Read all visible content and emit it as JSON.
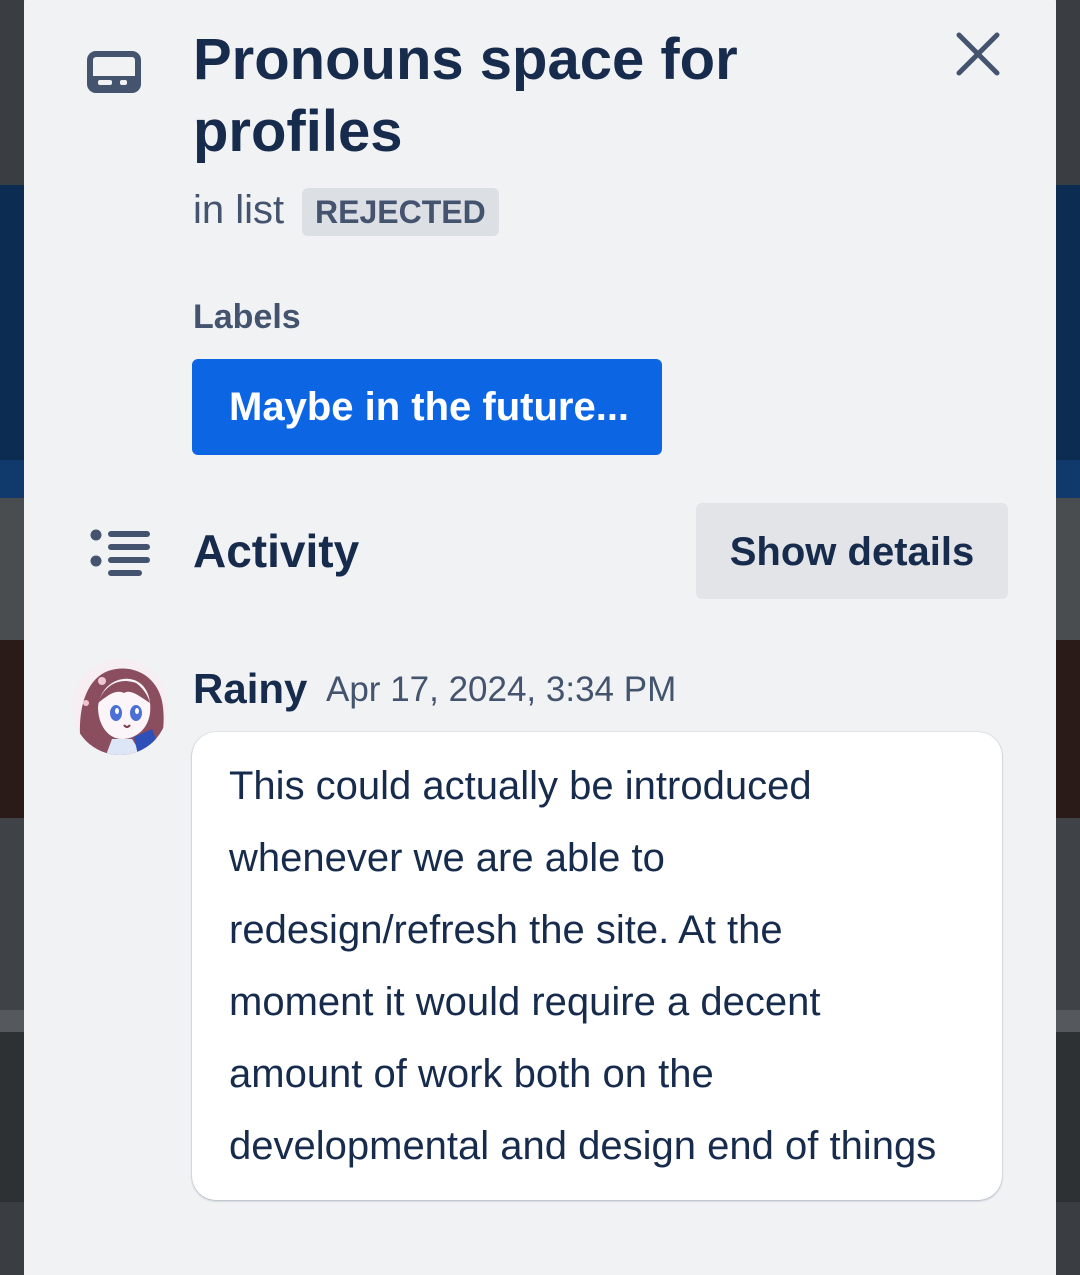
{
  "card": {
    "title": "Pronouns space for profiles",
    "in_list_prefix": "in list",
    "list_name": "REJECTED"
  },
  "labels": {
    "heading": "Labels",
    "items": [
      "Maybe in the future..."
    ],
    "chip_color": "#0c66e4"
  },
  "activity": {
    "heading": "Activity",
    "show_details_label": "Show details"
  },
  "comment": {
    "author": "Rainy",
    "timestamp": "Apr 17, 2024, 3:34 PM",
    "text": "This could actually be introduced\nwhenever we are able to\nredesign/refresh the site. At the\nmoment it would require a decent\namount of work both on the\ndevelopmental and design end of things"
  },
  "icons": {
    "card": "card-icon",
    "close": "close-icon",
    "activity": "activity-list-icon",
    "avatar": "user-avatar"
  },
  "colors": {
    "modal_bg": "#f1f2f4",
    "text_primary": "#172b4d",
    "text_subtle": "#44546f",
    "badge_bg": "#dcdfe4",
    "button_bg": "#e2e4e8",
    "label_blue": "#0c66e4"
  }
}
